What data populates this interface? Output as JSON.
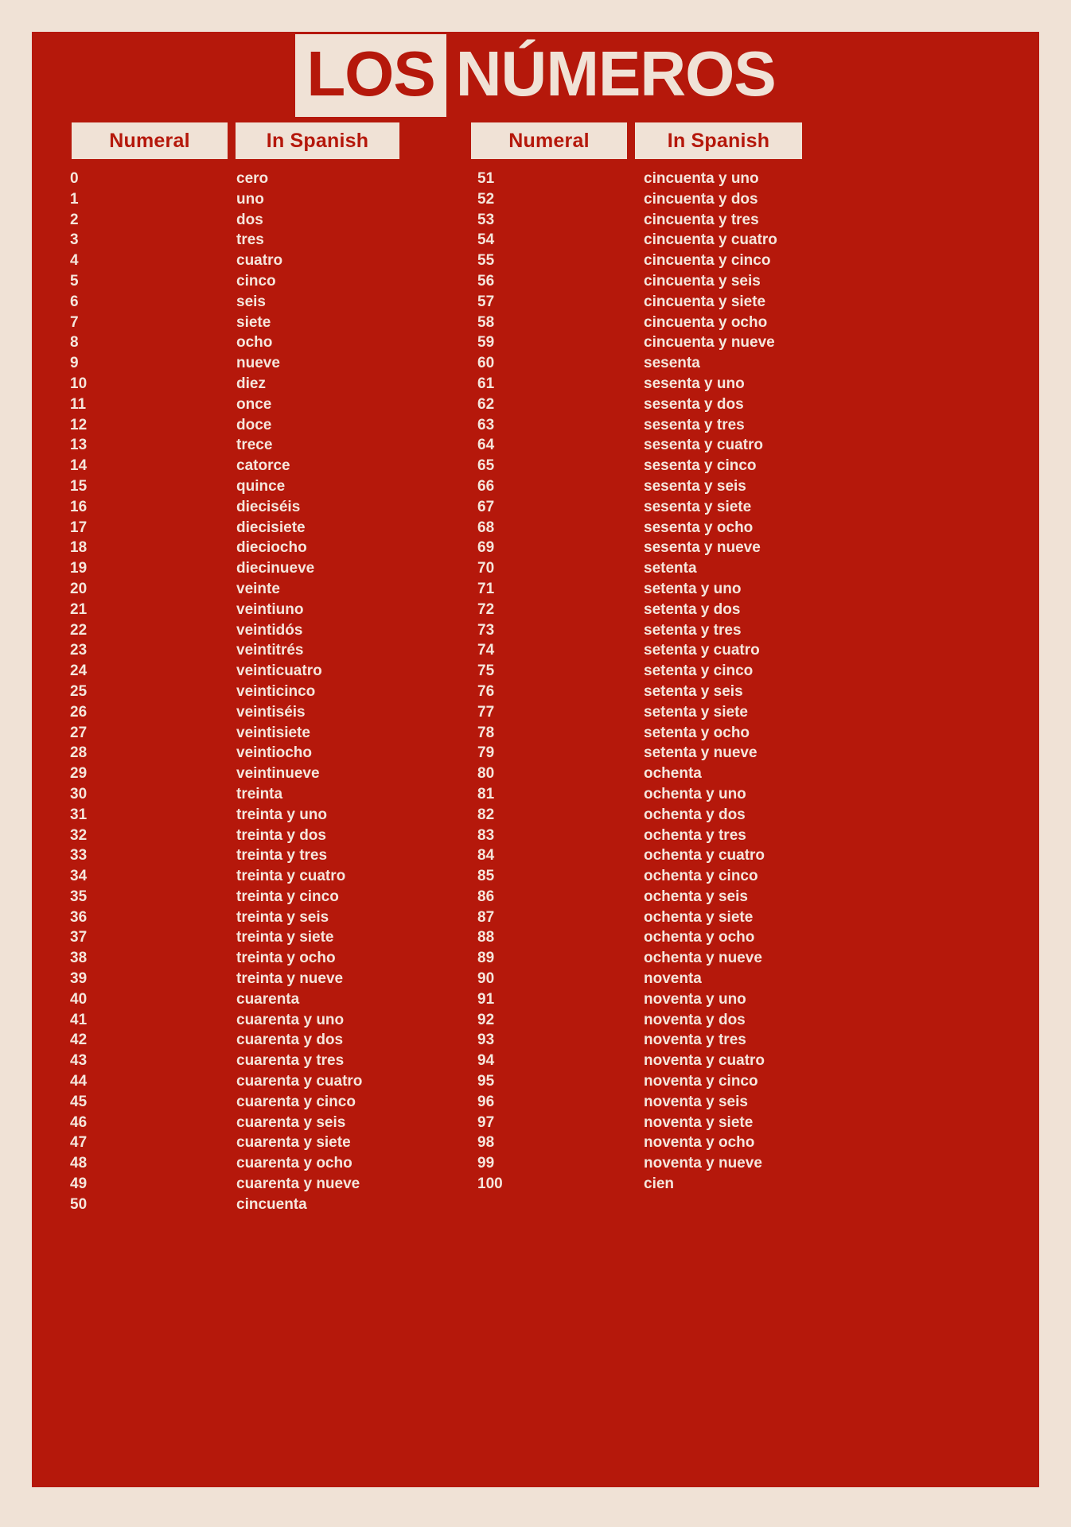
{
  "page": {
    "background_color": "#F0E2D6",
    "panel_color": "#B5180B",
    "text_color": "#F5E6DC"
  },
  "title": {
    "word1": "LOS",
    "word2": "NÚMEROS"
  },
  "headers": {
    "numeral": "Numeral",
    "in_spanish": "In Spanish"
  },
  "columns": [
    {
      "id": "left",
      "rows": [
        {
          "numeral": "0",
          "spanish": "cero"
        },
        {
          "numeral": "1",
          "spanish": "uno"
        },
        {
          "numeral": "2",
          "spanish": "dos"
        },
        {
          "numeral": "3",
          "spanish": "tres"
        },
        {
          "numeral": "4",
          "spanish": "cuatro"
        },
        {
          "numeral": "5",
          "spanish": "cinco"
        },
        {
          "numeral": "6",
          "spanish": "seis"
        },
        {
          "numeral": "7",
          "spanish": "siete"
        },
        {
          "numeral": "8",
          "spanish": "ocho"
        },
        {
          "numeral": "9",
          "spanish": "nueve"
        },
        {
          "numeral": "10",
          "spanish": "diez"
        },
        {
          "numeral": "11",
          "spanish": "once"
        },
        {
          "numeral": "12",
          "spanish": "doce"
        },
        {
          "numeral": "13",
          "spanish": "trece"
        },
        {
          "numeral": "14",
          "spanish": "catorce"
        },
        {
          "numeral": "15",
          "spanish": "quince"
        },
        {
          "numeral": "16",
          "spanish": "dieciséis"
        },
        {
          "numeral": "17",
          "spanish": "diecisiete"
        },
        {
          "numeral": "18",
          "spanish": "dieciocho"
        },
        {
          "numeral": "19",
          "spanish": "diecinueve"
        },
        {
          "numeral": "20",
          "spanish": "veinte"
        },
        {
          "numeral": "21",
          "spanish": "veintiuno"
        },
        {
          "numeral": "22",
          "spanish": "veintidós"
        },
        {
          "numeral": "23",
          "spanish": "veintitrés"
        },
        {
          "numeral": "24",
          "spanish": "veinticuatro"
        },
        {
          "numeral": "25",
          "spanish": "veinticinco"
        },
        {
          "numeral": "26",
          "spanish": "veintiséis"
        },
        {
          "numeral": "27",
          "spanish": "veintisiete"
        },
        {
          "numeral": "28",
          "spanish": "veintiocho"
        },
        {
          "numeral": "29",
          "spanish": "veintinueve"
        },
        {
          "numeral": "30",
          "spanish": "treinta"
        },
        {
          "numeral": "31",
          "spanish": "treinta y uno"
        },
        {
          "numeral": "32",
          "spanish": "treinta y dos"
        },
        {
          "numeral": "33",
          "spanish": "treinta y tres"
        },
        {
          "numeral": "34",
          "spanish": "treinta y cuatro"
        },
        {
          "numeral": "35",
          "spanish": "treinta y cinco"
        },
        {
          "numeral": "36",
          "spanish": "treinta y seis"
        },
        {
          "numeral": "37",
          "spanish": "treinta y siete"
        },
        {
          "numeral": "38",
          "spanish": "treinta y ocho"
        },
        {
          "numeral": "39",
          "spanish": "treinta y nueve"
        },
        {
          "numeral": "40",
          "spanish": "cuarenta"
        },
        {
          "numeral": "41",
          "spanish": "cuarenta y uno"
        },
        {
          "numeral": "42",
          "spanish": "cuarenta y dos"
        },
        {
          "numeral": "43",
          "spanish": "cuarenta y tres"
        },
        {
          "numeral": "44",
          "spanish": "cuarenta y cuatro"
        },
        {
          "numeral": "45",
          "spanish": "cuarenta y cinco"
        },
        {
          "numeral": "46",
          "spanish": "cuarenta y seis"
        },
        {
          "numeral": "47",
          "spanish": "cuarenta y siete"
        },
        {
          "numeral": "48",
          "spanish": "cuarenta y ocho"
        },
        {
          "numeral": "49",
          "spanish": "cuarenta y nueve"
        },
        {
          "numeral": "50",
          "spanish": "cincuenta"
        }
      ]
    },
    {
      "id": "right",
      "rows": [
        {
          "numeral": "51",
          "spanish": "cincuenta y uno"
        },
        {
          "numeral": "52",
          "spanish": "cincuenta y dos"
        },
        {
          "numeral": "53",
          "spanish": "cincuenta y tres"
        },
        {
          "numeral": "54",
          "spanish": "cincuenta y cuatro"
        },
        {
          "numeral": "55",
          "spanish": "cincuenta y cinco"
        },
        {
          "numeral": "56",
          "spanish": "cincuenta y seis"
        },
        {
          "numeral": "57",
          "spanish": "cincuenta y siete"
        },
        {
          "numeral": "58",
          "spanish": "cincuenta y ocho"
        },
        {
          "numeral": "59",
          "spanish": "cincuenta y nueve"
        },
        {
          "numeral": "60",
          "spanish": "sesenta"
        },
        {
          "numeral": "61",
          "spanish": "sesenta y uno"
        },
        {
          "numeral": "62",
          "spanish": "sesenta y dos"
        },
        {
          "numeral": "63",
          "spanish": "sesenta y tres"
        },
        {
          "numeral": "64",
          "spanish": "sesenta y cuatro"
        },
        {
          "numeral": "65",
          "spanish": "sesenta y cinco"
        },
        {
          "numeral": "66",
          "spanish": "sesenta y seis"
        },
        {
          "numeral": "67",
          "spanish": "sesenta y siete"
        },
        {
          "numeral": "68",
          "spanish": "sesenta y ocho"
        },
        {
          "numeral": "69",
          "spanish": "sesenta y nueve"
        },
        {
          "numeral": "70",
          "spanish": "setenta"
        },
        {
          "numeral": "71",
          "spanish": "setenta y uno"
        },
        {
          "numeral": "72",
          "spanish": "setenta y dos"
        },
        {
          "numeral": "73",
          "spanish": "setenta y tres"
        },
        {
          "numeral": "74",
          "spanish": "setenta y cuatro"
        },
        {
          "numeral": "75",
          "spanish": "setenta y cinco"
        },
        {
          "numeral": "76",
          "spanish": "setenta y seis"
        },
        {
          "numeral": "77",
          "spanish": "setenta y siete"
        },
        {
          "numeral": "78",
          "spanish": "setenta y ocho"
        },
        {
          "numeral": "79",
          "spanish": "setenta y nueve"
        },
        {
          "numeral": "80",
          "spanish": "ochenta"
        },
        {
          "numeral": "81",
          "spanish": "ochenta y uno"
        },
        {
          "numeral": "82",
          "spanish": "ochenta y dos"
        },
        {
          "numeral": "83",
          "spanish": "ochenta y tres"
        },
        {
          "numeral": "84",
          "spanish": "ochenta y cuatro"
        },
        {
          "numeral": "85",
          "spanish": "ochenta y cinco"
        },
        {
          "numeral": "86",
          "spanish": "ochenta y seis"
        },
        {
          "numeral": "87",
          "spanish": "ochenta y siete"
        },
        {
          "numeral": "88",
          "spanish": "ochenta y ocho"
        },
        {
          "numeral": "89",
          "spanish": "ochenta y nueve"
        },
        {
          "numeral": "90",
          "spanish": "noventa"
        },
        {
          "numeral": "91",
          "spanish": "noventa y uno"
        },
        {
          "numeral": "92",
          "spanish": "noventa y dos"
        },
        {
          "numeral": "93",
          "spanish": "noventa y tres"
        },
        {
          "numeral": "94",
          "spanish": "noventa y cuatro"
        },
        {
          "numeral": "95",
          "spanish": "noventa y cinco"
        },
        {
          "numeral": "96",
          "spanish": "noventa y seis"
        },
        {
          "numeral": "97",
          "spanish": "noventa y siete"
        },
        {
          "numeral": "98",
          "spanish": "noventa y ocho"
        },
        {
          "numeral": "99",
          "spanish": "noventa y nueve"
        },
        {
          "numeral": "100",
          "spanish": "cien"
        }
      ]
    }
  ]
}
